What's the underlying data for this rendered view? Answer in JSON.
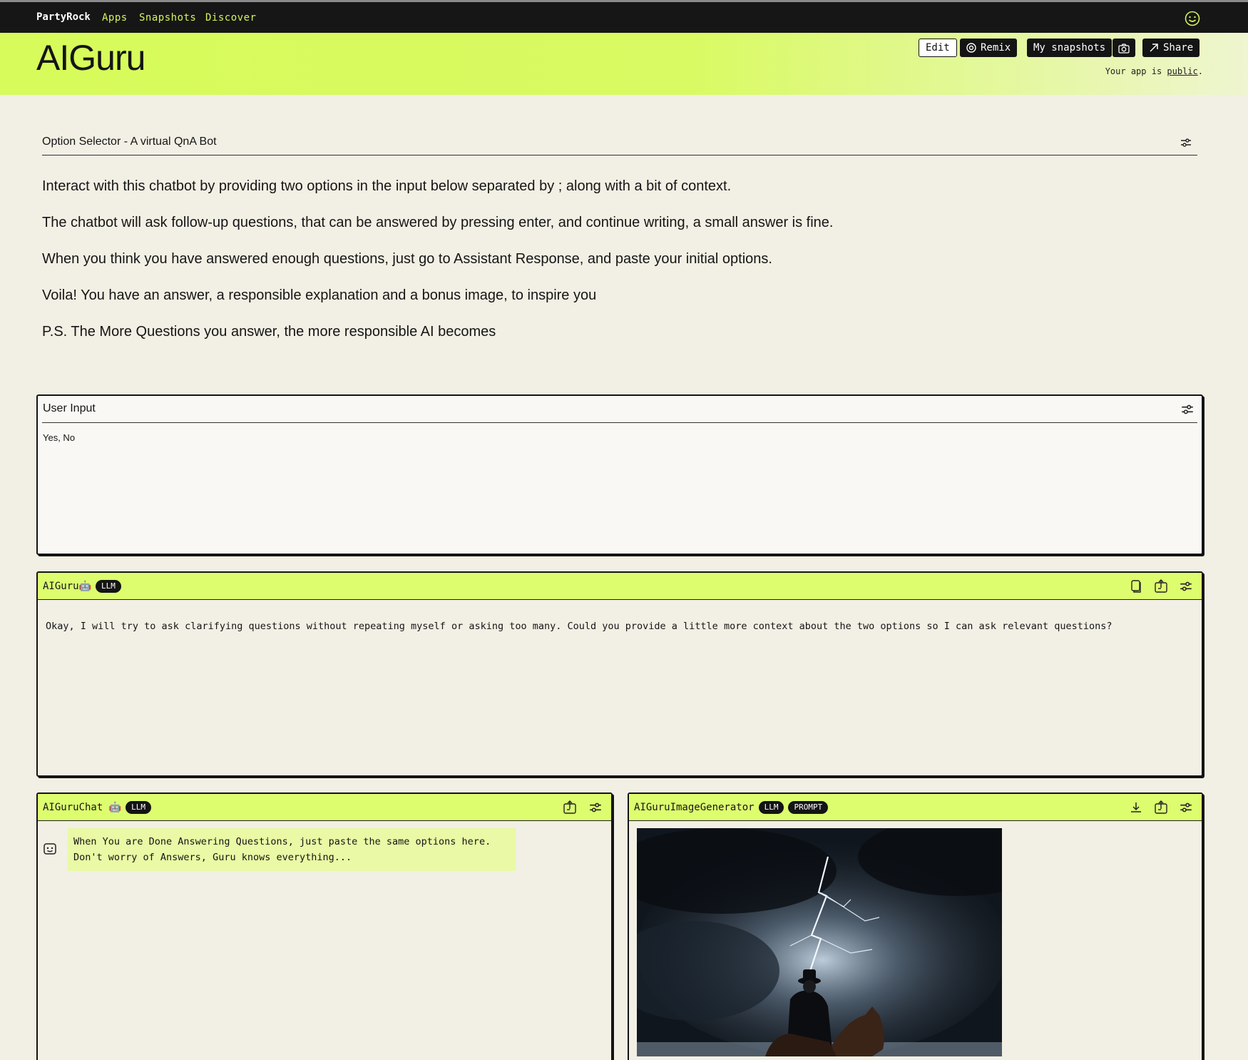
{
  "topbar": {
    "brand": "PartyRock",
    "nav": [
      "Apps",
      "Snapshots",
      "Discover"
    ]
  },
  "header": {
    "title": "AIGuru",
    "buttons": {
      "edit": "Edit",
      "remix": "Remix",
      "my_snapshots": "My snapshots",
      "share": "Share"
    },
    "public_prefix": "Your app is ",
    "public_link": "public",
    "public_suffix": "."
  },
  "description": {
    "title": "Option Selector - A virtual QnA Bot",
    "paragraphs": [
      "Interact with this chatbot by providing two options in the input below separated by ; along with a bit of context.",
      "The chatbot will ask follow-up questions, that can be answered by pressing enter, and continue writing, a small answer is fine.",
      "When you think you have answered enough questions, just go to Assistant Response, and paste your initial options.",
      "Voila! You have an answer, a responsible explanation and a bonus image, to inspire you",
      "P.S. The More Questions you answer, the more responsible AI becomes"
    ]
  },
  "user_input": {
    "title": "User Input",
    "value": "Yes, No"
  },
  "aiguru": {
    "title": "AIGuru🤖",
    "badge": "LLM",
    "output": "Okay, I will try to ask clarifying questions without repeating myself or asking too many. Could you provide a little more context about the two options so I can ask relevant questions?"
  },
  "aiguru_chat": {
    "title": "AIGuruChat 🤖",
    "badge": "LLM",
    "message": "When You are Done Answering Questions, just paste the same options here. Don't worry of Answers, Guru knows everything..."
  },
  "image_gen": {
    "title": "AIGuruImageGenerator",
    "badges": [
      "LLM",
      "PROMPT"
    ]
  },
  "colors": {
    "accent": "#ddfd6f",
    "topbar": "#161616",
    "nav_link": "#d4f45c",
    "background": "#f2efe4"
  }
}
